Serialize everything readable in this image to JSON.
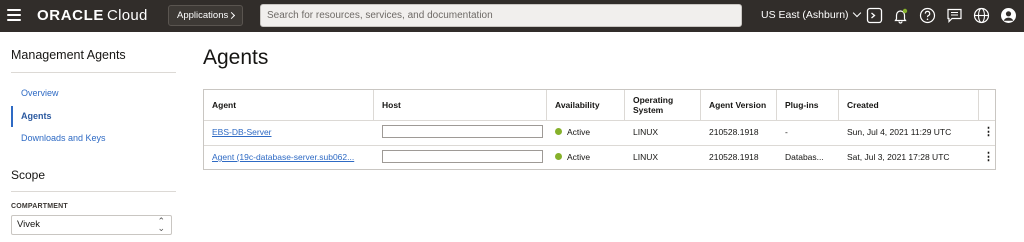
{
  "topbar": {
    "brand_oracle": "ORACLE",
    "brand_cloud": "Cloud",
    "applications_label": "Applications",
    "search_placeholder": "Search for resources, services, and documentation",
    "region_label": "US East (Ashburn)",
    "icons": [
      "menu-icon",
      "cloud-shell-icon",
      "notifications-icon",
      "help-icon",
      "feedback-icon",
      "language-icon",
      "profile-icon"
    ]
  },
  "sidebar": {
    "title": "Management Agents",
    "items": [
      {
        "label": "Overview",
        "active": false
      },
      {
        "label": "Agents",
        "active": true
      },
      {
        "label": "Downloads and Keys",
        "active": false
      }
    ],
    "scope_title": "Scope",
    "compartment_label": "COMPARTMENT",
    "compartment_value": "Vivek"
  },
  "main": {
    "title": "Agents",
    "table": {
      "columns": [
        "Agent",
        "Host",
        "Availability",
        "Operating System",
        "Agent Version",
        "Plug-ins",
        "Created"
      ],
      "rows": [
        {
          "agent": "EBS-DB-Server",
          "host": "",
          "availability": "Active",
          "os": "LINUX",
          "version": "210528.1918",
          "plugins": "-",
          "created": "Sun, Jul 4, 2021 11:29 UTC"
        },
        {
          "agent": "Agent (19c-database-server.sub062...",
          "host": "",
          "availability": "Active",
          "os": "LINUX",
          "version": "210528.1918",
          "plugins": "Databas...",
          "created": "Sat, Jul 3, 2021 17:28 UTC"
        }
      ]
    }
  },
  "colors": {
    "topbar_bg": "#312d2a",
    "link": "#2e6ac4",
    "status_active": "#86b12b"
  }
}
